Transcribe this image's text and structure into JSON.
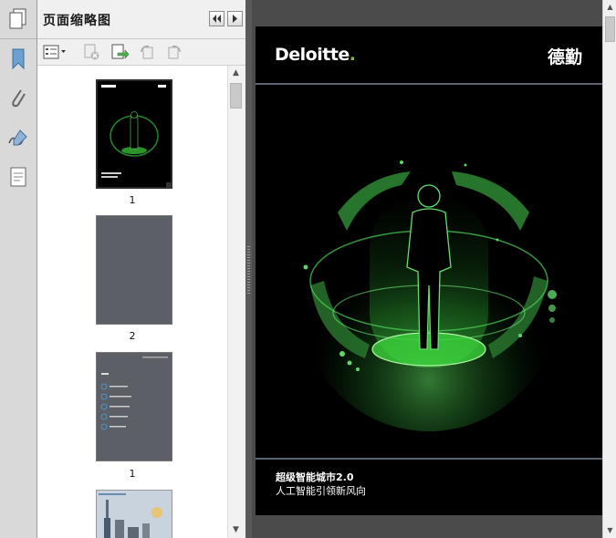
{
  "panel": {
    "title": "页面缩略图"
  },
  "thumbnails": [
    {
      "label": "1",
      "kind": "cover"
    },
    {
      "label": "2",
      "kind": "blank"
    },
    {
      "label": "1",
      "kind": "toc"
    },
    {
      "label": "",
      "kind": "city"
    }
  ],
  "document": {
    "logo": "Deloitte",
    "logo_dot": ".",
    "cn_logo": "德勤",
    "title": "超级智能城市2.0",
    "subtitle": "人工智能引领新风向"
  },
  "colors": {
    "accent_green": "#86bc25",
    "glow_green": "#3cd23c",
    "page_bg": "#000000",
    "viewer_bg": "#4b4b4b"
  }
}
